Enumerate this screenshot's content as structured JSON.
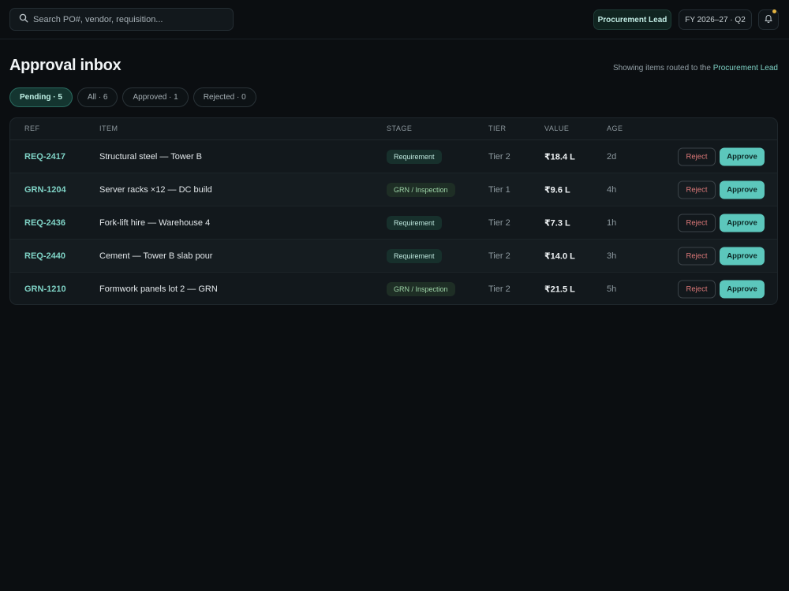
{
  "header": {
    "search_placeholder": "Search PO#, vendor, requisition...",
    "role": "Procurement Lead",
    "period": "FY 2026–27 · Q2"
  },
  "page": {
    "title": "Approval inbox",
    "routing_prefix": "Showing items routed to the ",
    "routing_role": "Procurement Lead"
  },
  "filters": [
    {
      "label": "Pending · 5",
      "active": true
    },
    {
      "label": "All · 6",
      "active": false
    },
    {
      "label": "Approved · 1",
      "active": false
    },
    {
      "label": "Rejected · 0",
      "active": false
    }
  ],
  "table": {
    "columns": {
      "ref": "REF",
      "item": "ITEM",
      "stage": "STAGE",
      "tier": "TIER",
      "value": "VALUE",
      "age": "AGE"
    },
    "reject_label": "Reject",
    "approve_label": "Approve",
    "rows": [
      {
        "ref": "REQ-2417",
        "item": "Structural steel — Tower B",
        "stage": "Requirement",
        "stage_kind": "req",
        "tier": "Tier 2",
        "value": "₹18.4 L",
        "age": "2d"
      },
      {
        "ref": "GRN-1204",
        "item": "Server racks ×12 — DC build",
        "stage": "GRN / Inspection",
        "stage_kind": "grn",
        "tier": "Tier 1",
        "value": "₹9.6 L",
        "age": "4h"
      },
      {
        "ref": "REQ-2436",
        "item": "Fork-lift hire — Warehouse 4",
        "stage": "Requirement",
        "stage_kind": "req",
        "tier": "Tier 2",
        "value": "₹7.3 L",
        "age": "1h"
      },
      {
        "ref": "REQ-2440",
        "item": "Cement — Tower B slab pour",
        "stage": "Requirement",
        "stage_kind": "req",
        "tier": "Tier 2",
        "value": "₹14.0 L",
        "age": "3h"
      },
      {
        "ref": "GRN-1210",
        "item": "Formwork panels lot 2 — GRN",
        "stage": "GRN / Inspection",
        "stage_kind": "grn",
        "tier": "Tier 2",
        "value": "₹21.5 L",
        "age": "5h"
      }
    ]
  },
  "colors": {
    "accent": "#5cc7bc",
    "reject": "#e07a7a",
    "notification": "#e3b341"
  }
}
